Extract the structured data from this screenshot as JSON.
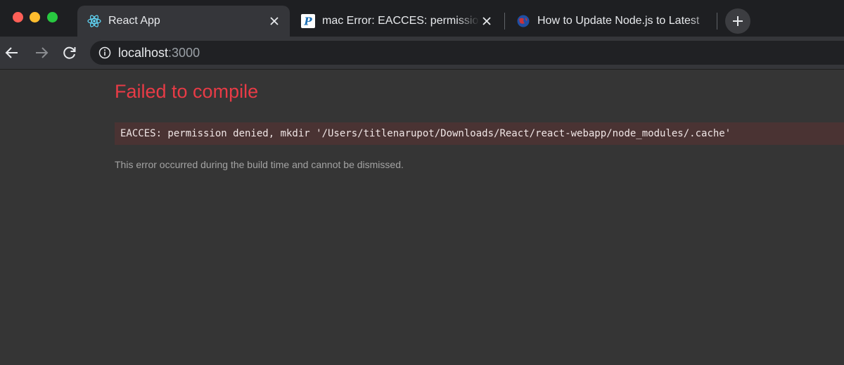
{
  "window": {
    "traffic_lights": [
      "close",
      "minimize",
      "zoom"
    ]
  },
  "tabs": [
    {
      "title": "React App",
      "favicon": "react-logo-icon",
      "active": true
    },
    {
      "title": "mac Error: EACCES: permission",
      "favicon": "p-logo-icon",
      "active": false
    },
    {
      "title": "How to Update Node.js to Latest",
      "favicon": "globe-icon",
      "active": false
    }
  ],
  "toolbar": {
    "url_host": "localhost",
    "url_port": ":3000"
  },
  "page": {
    "title": "Failed to compile",
    "error_message": "EACCES: permission denied, mkdir '/Users/titlenarupot/Downloads/React/react-webapp/node_modules/.cache'",
    "note": "This error occurred during the build time and cannot be dismissed."
  },
  "colors": {
    "error_red": "#e83b46",
    "background": "#353535",
    "error_box": "#4a3333"
  }
}
